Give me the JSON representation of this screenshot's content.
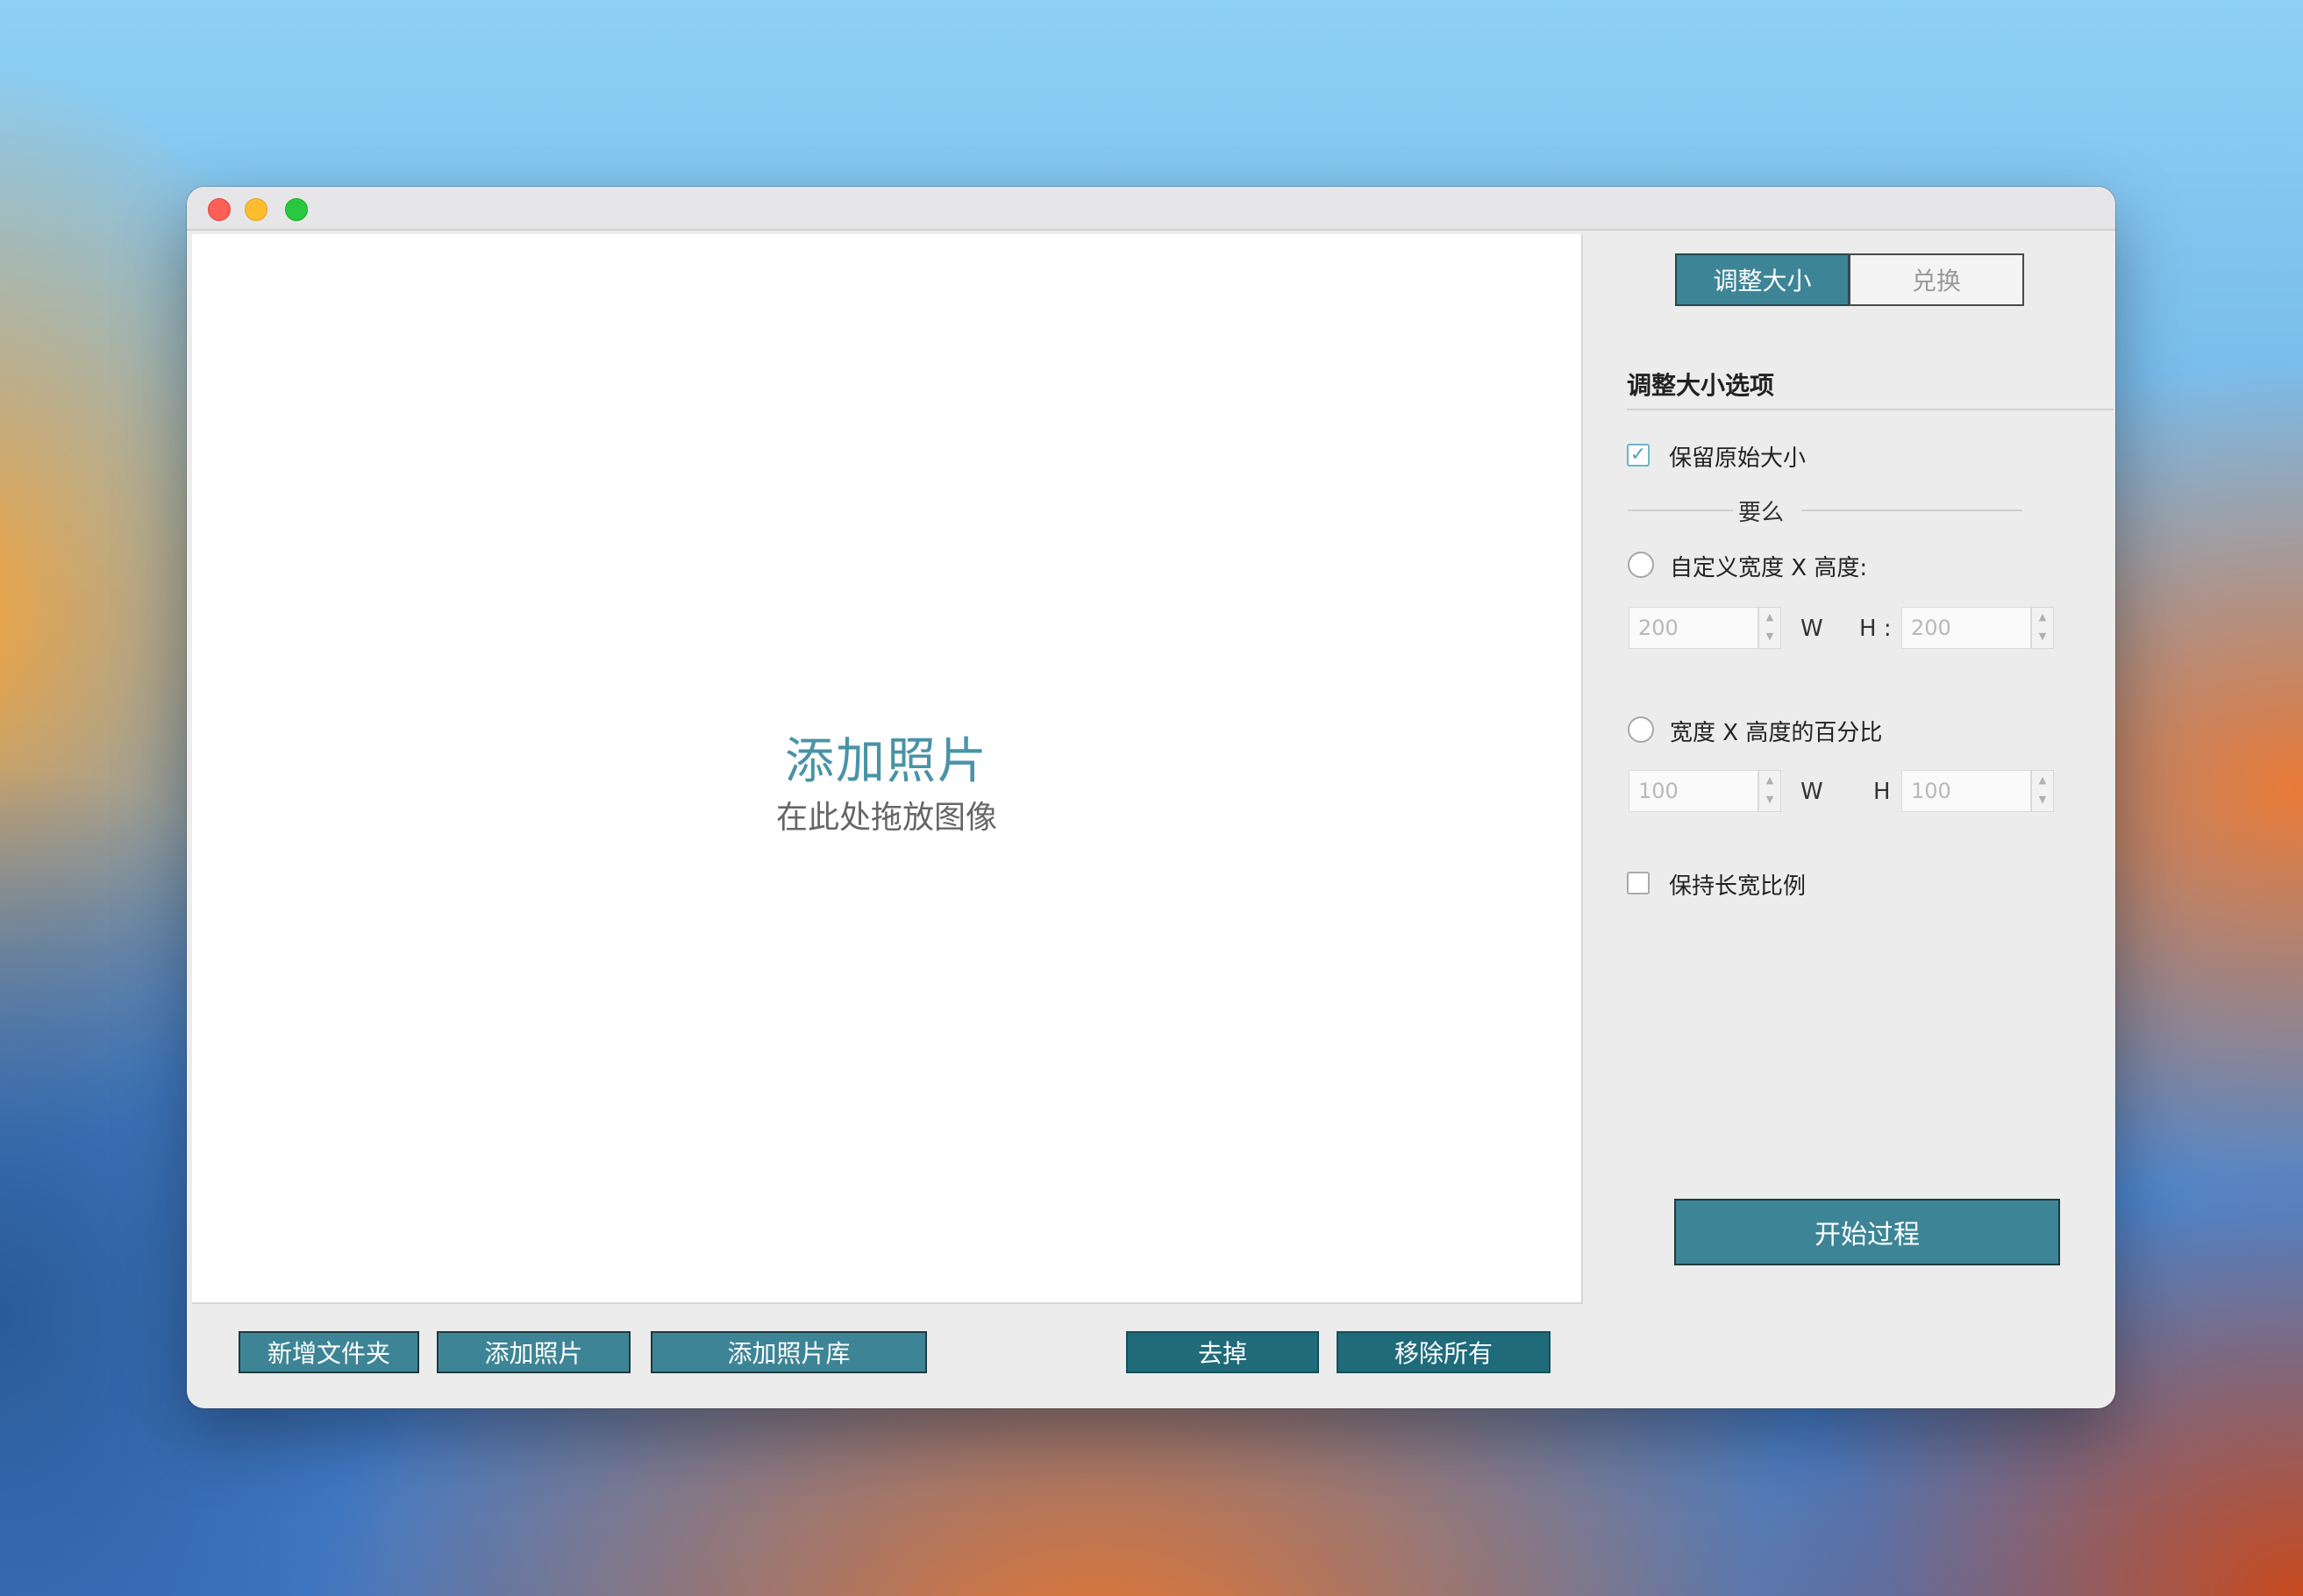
{
  "window": {
    "traffic_lights": {
      "close": "#fe5f57",
      "minimize": "#febc2e",
      "maximize": "#28c840"
    }
  },
  "dropzone": {
    "title": "添加照片",
    "subtitle": "在此处拖放图像"
  },
  "bottom_bar": {
    "new_folder": "新增文件夹",
    "add_photos": "添加照片",
    "add_library": "添加照片库",
    "remove": "去掉",
    "remove_all": "移除所有"
  },
  "tabs": {
    "resize": "调整大小",
    "convert": "兑换",
    "active": "resize"
  },
  "resize_options": {
    "title": "调整大小选项",
    "keep_original": {
      "label": "保留原始大小",
      "checked": true
    },
    "or_label": "要么",
    "custom": {
      "label": "自定义宽度 X 高度:",
      "selected": false,
      "width": "200",
      "w_label": "W",
      "h_label": "H :",
      "height": "200"
    },
    "percent": {
      "label": "宽度 X 高度的百分比",
      "selected": false,
      "width": "100",
      "w_label": "W",
      "h_label": "H",
      "height": "100"
    },
    "keep_ratio": {
      "label": "保持长宽比例",
      "checked": false
    }
  },
  "start_button": "开始过程",
  "colors": {
    "accent": "#3d8596",
    "accent_dark": "#1f6b7a",
    "drop_title": "#4a93a6"
  }
}
